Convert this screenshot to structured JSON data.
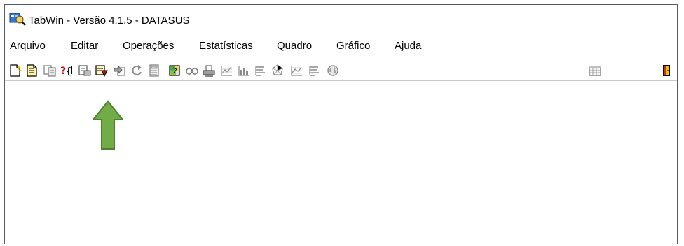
{
  "window": {
    "title": "TabWin - Versão 4.1.5 - DATASUS"
  },
  "menu": {
    "items": [
      {
        "label": "Arquivo"
      },
      {
        "label": "Editar"
      },
      {
        "label": "Operações"
      },
      {
        "label": "Estatísticas"
      },
      {
        "label": "Quadro"
      },
      {
        "label": "Gráfico"
      },
      {
        "label": "Ajuda"
      }
    ]
  },
  "toolbar": {
    "buttons": [
      {
        "icon": "new-document-icon"
      },
      {
        "icon": "open-document-icon"
      },
      {
        "icon": "copy-document-icon"
      },
      {
        "icon": "help-query-icon"
      },
      {
        "icon": "print-preview-icon"
      },
      {
        "icon": "execute-table-icon"
      },
      {
        "icon": "import-icon"
      },
      {
        "icon": "refresh-icon"
      },
      {
        "icon": "calculator-icon"
      },
      {
        "icon": "map-icon"
      },
      {
        "icon": "glasses-icon"
      },
      {
        "icon": "printer-icon"
      },
      {
        "icon": "chart-icon"
      },
      {
        "icon": "bar-chart-icon"
      },
      {
        "icon": "list-icon"
      },
      {
        "icon": "radar-chart-icon"
      },
      {
        "icon": "line-chart-icon"
      },
      {
        "icon": "list-2-icon"
      },
      {
        "icon": "globe-icon"
      },
      {
        "icon": "spreadsheet-icon"
      },
      {
        "icon": "exit-door-icon"
      }
    ]
  },
  "colors": {
    "annotation_arrow": "#70ad47",
    "annotation_arrow_border": "#507e32",
    "title_icon": "#1f6fc9"
  }
}
